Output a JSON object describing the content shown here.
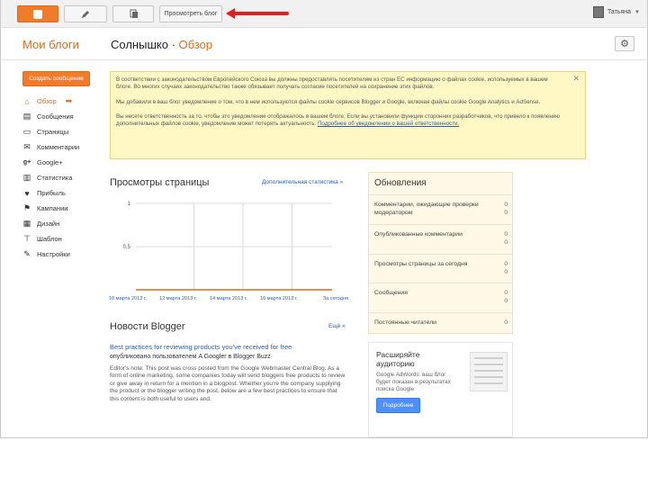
{
  "topbar": {
    "view_blog": "Просмотреть блог",
    "user_name": "Татьяна"
  },
  "header": {
    "blogs_title": "Мои блоги",
    "blog_name": "Солнышко",
    "separator": "·",
    "section": "Обзор"
  },
  "sidebar": {
    "new_post": "Создать сообщение",
    "items": [
      {
        "label": "Обзор",
        "icon": "home-icon"
      },
      {
        "label": "Сообщения",
        "icon": "posts-icon"
      },
      {
        "label": "Страницы",
        "icon": "pages-icon"
      },
      {
        "label": "Комментарии",
        "icon": "comments-icon"
      },
      {
        "label": "Google+",
        "icon": "google-plus-icon"
      },
      {
        "label": "Статистика",
        "icon": "stats-icon"
      },
      {
        "label": "Прибыль",
        "icon": "earnings-icon"
      },
      {
        "label": "Кампании",
        "icon": "campaigns-icon"
      },
      {
        "label": "Дизайн",
        "icon": "layout-icon"
      },
      {
        "label": "Шаблон",
        "icon": "template-icon"
      },
      {
        "label": "Настройки",
        "icon": "settings-icon"
      }
    ]
  },
  "notice": {
    "p1": "В соответствии с законодательством Европейского Союза вы должны предоставлять посетителям из стран ЕС информацию о файлах cookie, используемых в вашем блоге. Во многих случаях законодательство также обязывает получать согласие посетителей на сохранение этих файлов.",
    "p2": "Мы добавили в ваш блог уведомление о том, что в нем используются файлы cookie сервисов Blogger и Google, включая файлы cookie Google Analytics и AdSense.",
    "p3a": "Вы несете ответственность за то, чтобы это уведомление отображалось в вашем блоге. Если вы установили функции сторонних разработчиков, что привело к появлению дополнительных файлов cookie, уведомление может потерять актуальность.",
    "p3_link": "Подробнее об уведомлении о вашей ответственности."
  },
  "views": {
    "title": "Просмотры страницы",
    "more_link": "Дополнительная статистика »"
  },
  "chart_data": {
    "type": "line",
    "title": "Просмотры страницы",
    "x": [
      "10 марта 2013 г.",
      "12 марта 2013 г.",
      "14 марта 2013 г.",
      "16 марта 2013 г."
    ],
    "x_label_tail": "За сегодня",
    "y_ticks": [
      "1",
      "0,5"
    ],
    "ylim": [
      0,
      1
    ],
    "series": [
      {
        "values": [
          0,
          0,
          0,
          0
        ]
      }
    ],
    "grid": true,
    "colors": {
      "line": "#dd6c1c",
      "grid": "#d9d9d9"
    }
  },
  "news": {
    "title": "Новости Blogger",
    "more": "Ещё »",
    "headline": "Best practices for reviewing products you've received for free",
    "by": "опубликовано пользователем A Googler в Blogger Buzz",
    "body": "Editor's note: This post was cross posted from the Google Webmaster Central Blog. As a form of online marketing, some companies today will send bloggers free products to review or give away in return for a mention in a blogpost. Whether you're the company supplying the product or the blogger writing the post, below are a few best practices to ensure that this content is both useful to users and."
  },
  "updates": {
    "title": "Обновления",
    "rows": [
      {
        "label": "Комментарии, ожидающие проверки модератором",
        "count": "0",
        "count2": "0"
      },
      {
        "label": "Опубликованные комментарии",
        "count": "0",
        "count2": "0"
      },
      {
        "label": "Просмотры страницы за сегодня",
        "count": "0",
        "count2": "0"
      },
      {
        "label": "Сообщения",
        "count": "0",
        "count2": "0"
      },
      {
        "label": "Постоянные читатели",
        "count": "0",
        "count2": ""
      }
    ]
  },
  "ad": {
    "title": "Расширяйте аудиторию",
    "body": "Google AdWords: ваш блог будет показан в результатах поиска Google",
    "button": "Подробнее"
  }
}
